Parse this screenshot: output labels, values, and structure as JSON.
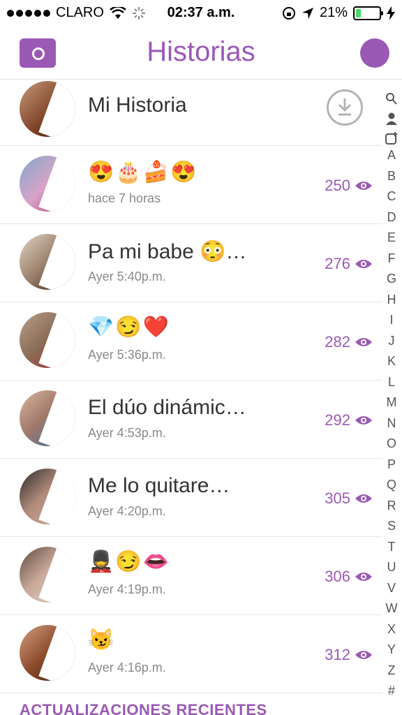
{
  "status": {
    "carrier": "CLARO",
    "time": "02:37 a.m.",
    "battery": "21%",
    "battery_fraction": 0.21
  },
  "header": {
    "title": "Historias"
  },
  "stories": [
    {
      "title": "Mi Historia"
    },
    {
      "emoji": "😍🎂🍰😍",
      "subtitle": "hace 7 horas",
      "views": "250"
    },
    {
      "title": "Pa mi babe 😳…",
      "subtitle": "Ayer 5:40p.m.",
      "views": "276"
    },
    {
      "emoji": "💎😏❤️",
      "subtitle": "Ayer 5:36p.m.",
      "views": "282"
    },
    {
      "title": "El dúo dinámic…",
      "subtitle": "Ayer 4:53p.m.",
      "views": "292"
    },
    {
      "title": "Me lo quitare…",
      "subtitle": "Ayer 4:20p.m.",
      "views": "305"
    },
    {
      "emoji": "💂😏👄",
      "subtitle": "Ayer 4:19p.m.",
      "views": "306"
    },
    {
      "emoji": "😼",
      "subtitle": "Ayer 4:16p.m.",
      "views": "312"
    }
  ],
  "index": [
    "A",
    "B",
    "C",
    "D",
    "E",
    "F",
    "G",
    "H",
    "I",
    "J",
    "K",
    "L",
    "M",
    "N",
    "O",
    "P",
    "Q",
    "R",
    "S",
    "T",
    "U",
    "V",
    "W",
    "X",
    "Y",
    "Z",
    "#"
  ],
  "section": {
    "title": "ACTUALIZACIONES RECIENTES"
  },
  "colors": {
    "accent": "#9b59b6"
  },
  "icons": {
    "camera": "camera-icon",
    "profile": "profile-icon",
    "download": "download-icon",
    "eye": "eye-icon",
    "search": "search-icon",
    "user": "user-icon",
    "add": "add-friend-icon"
  }
}
